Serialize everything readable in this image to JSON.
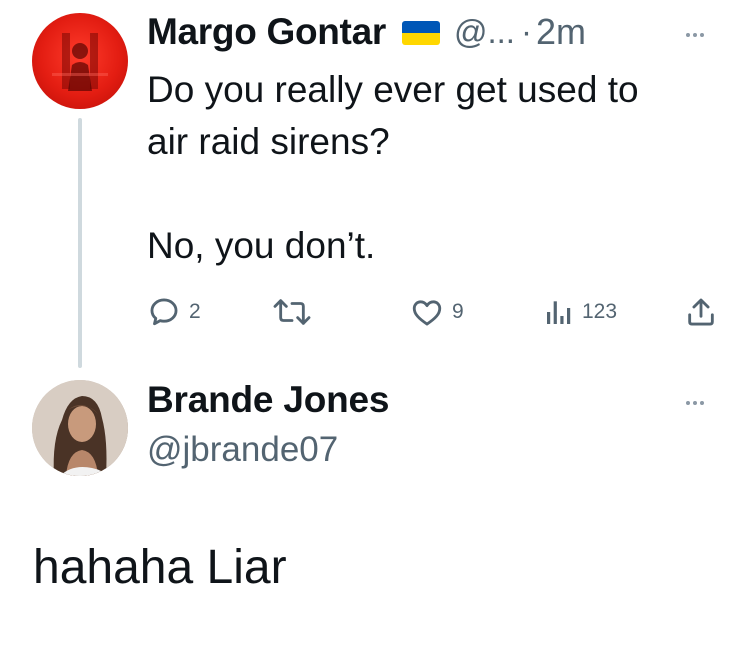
{
  "tweet": {
    "author_name": "Margo Gontar",
    "handle": "@...",
    "separator": "·",
    "time": "2m",
    "flag": "ukraine-flag",
    "text": "Do you really ever get used to\nair raid sirens?\n\nNo, you don’t.",
    "actions": {
      "reply_count": "2",
      "retweet_count": "",
      "like_count": "9",
      "view_count": "123"
    }
  },
  "reply": {
    "author_name": "Brande Jones",
    "handle": "@jbrande07",
    "text": "hahaha Liar"
  },
  "colors": {
    "text_primary": "#0f1419",
    "text_secondary": "#536471",
    "thread_line": "#cfd9de",
    "flag_blue": "#0057b7",
    "flag_yellow": "#ffd700"
  }
}
